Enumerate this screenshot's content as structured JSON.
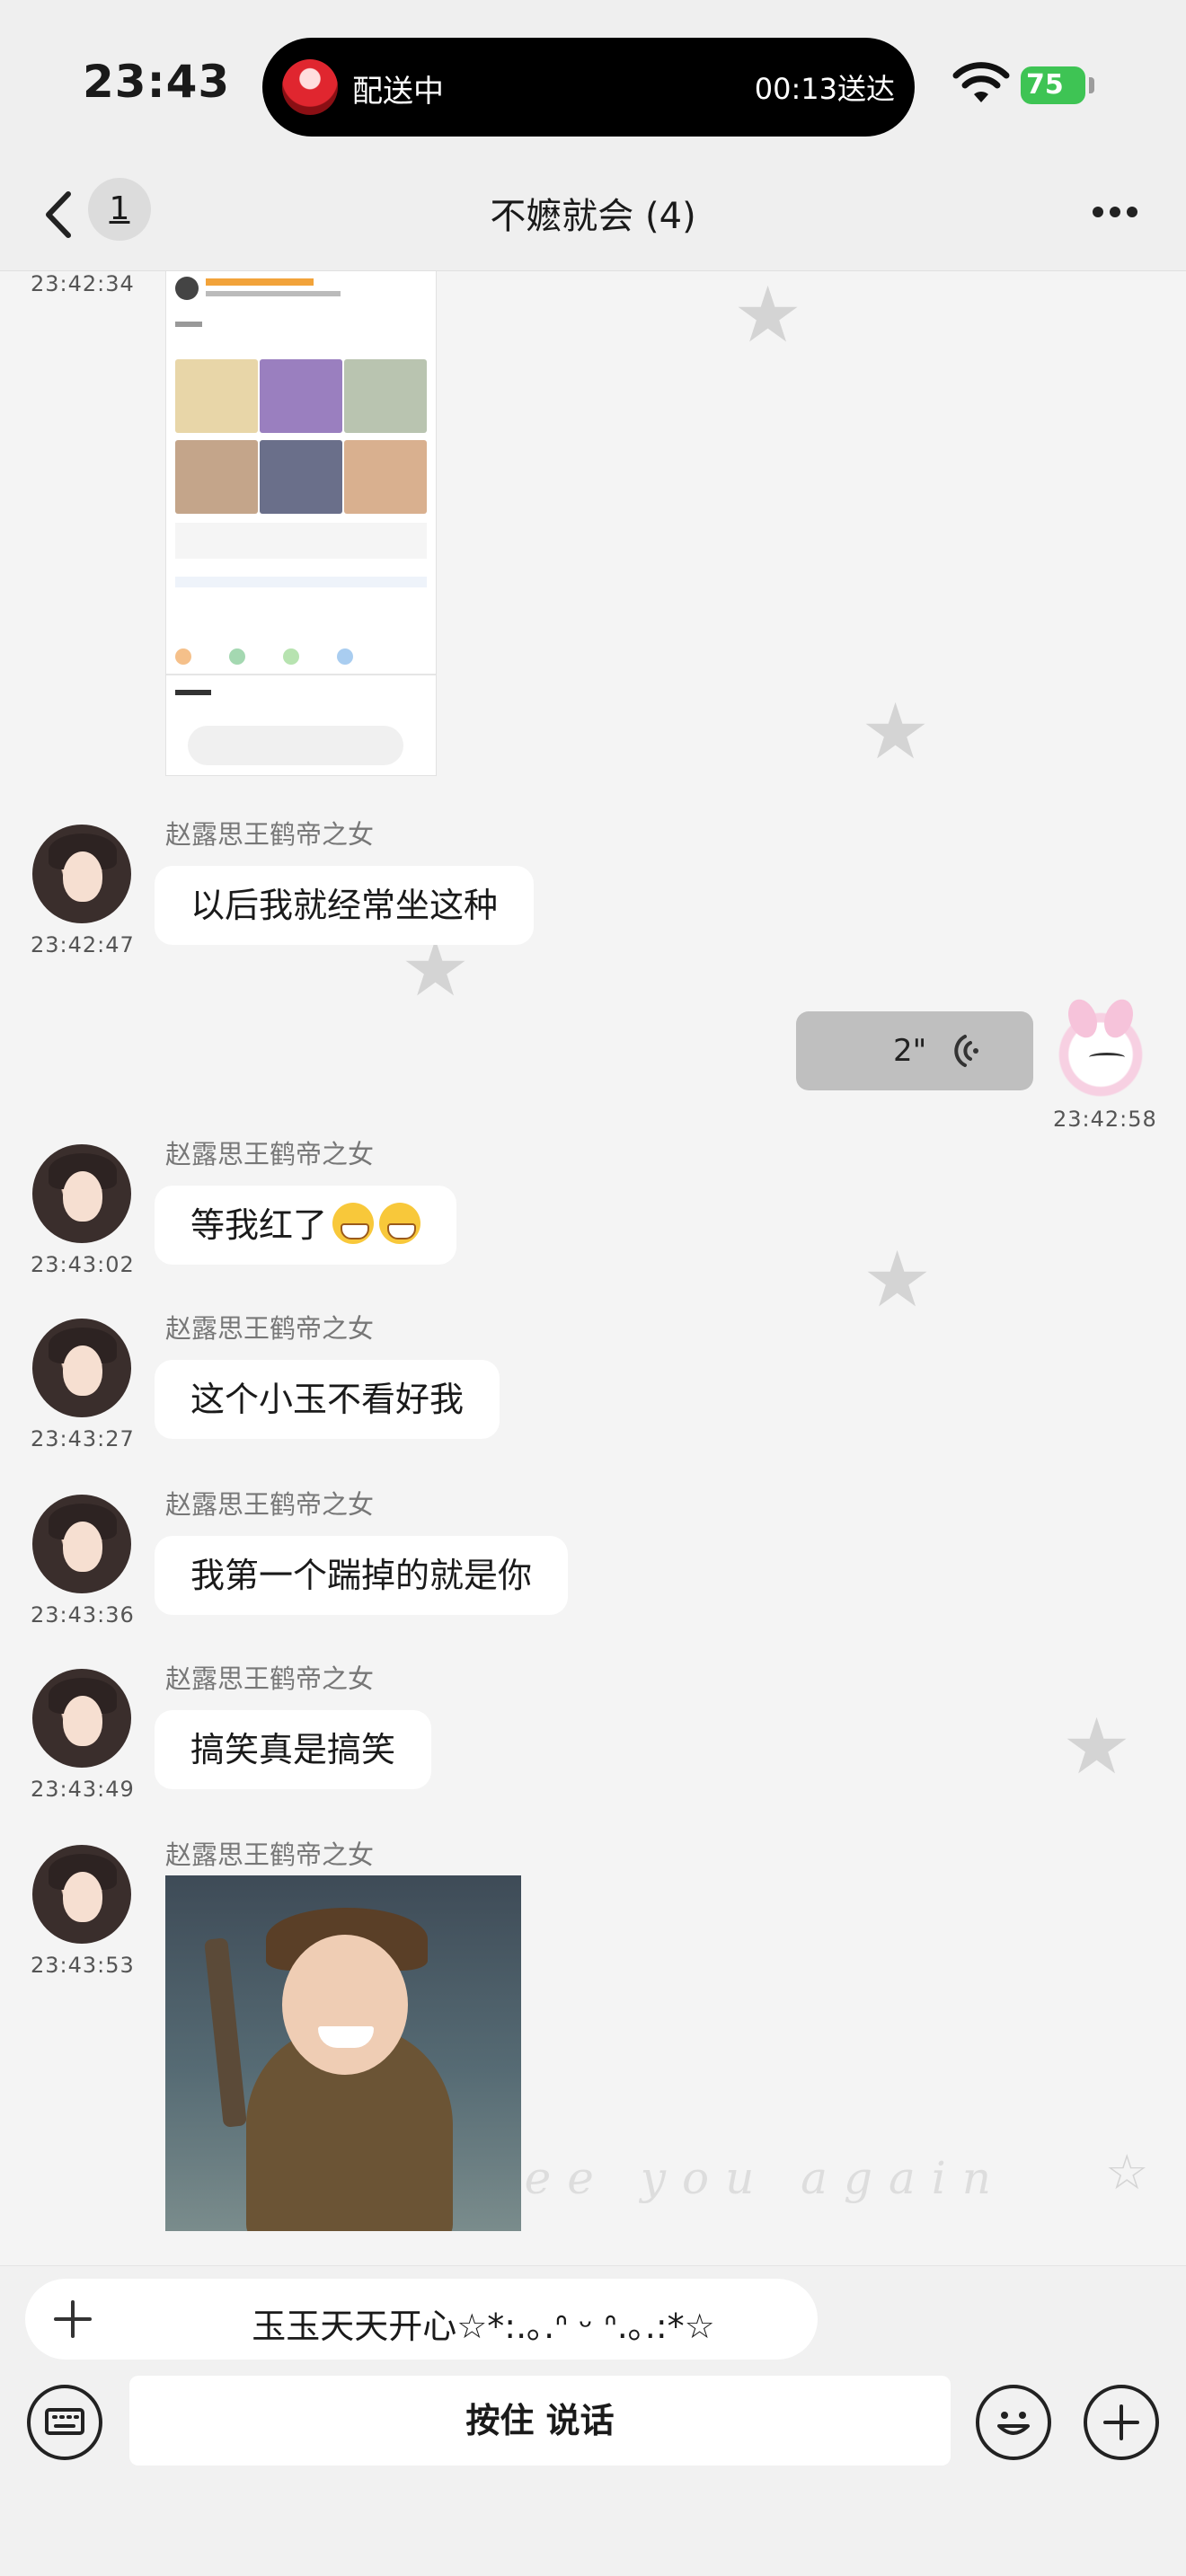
{
  "status_bar": {
    "time": "23:43",
    "island_label": "配送中",
    "island_eta": "00:13送达",
    "battery": "75"
  },
  "nav": {
    "unread_count": "1",
    "title": "不嬷就会 (4)"
  },
  "messages": [
    {
      "kind": "image",
      "from": "other",
      "time": "23:42:34",
      "content": "shared-screenshot"
    },
    {
      "kind": "text",
      "from": "other",
      "sender": "赵露思王鹤帝之女",
      "time": "23:42:47",
      "text": "以后我就经常坐这种"
    },
    {
      "kind": "voice",
      "from": "self",
      "time": "23:42:58",
      "duration": "2\""
    },
    {
      "kind": "text",
      "from": "other",
      "sender": "赵露思王鹤帝之女",
      "time": "23:43:02",
      "text": "等我红了",
      "emoji": [
        "grinning-emoji",
        "grinning-emoji"
      ]
    },
    {
      "kind": "text",
      "from": "other",
      "sender": "赵露思王鹤帝之女",
      "time": "23:43:27",
      "text": "这个小玉不看好我"
    },
    {
      "kind": "text",
      "from": "other",
      "sender": "赵露思王鹤帝之女",
      "time": "23:43:36",
      "text": "我第一个踹掉的就是你"
    },
    {
      "kind": "text",
      "from": "other",
      "sender": "赵露思王鹤帝之女",
      "time": "23:43:49",
      "text": "搞笑真是搞笑"
    },
    {
      "kind": "image",
      "from": "other",
      "sender": "赵露思王鹤帝之女",
      "time": "23:43:53",
      "content": "character-sticker"
    }
  ],
  "background_text": "see you again",
  "input": {
    "suggestion": "玉玉天天开心☆*:.｡.ᐢ ᵕ ᐢ.｡.:*☆",
    "hold_to_talk": "按住 说话"
  },
  "colors": {
    "page_bg": "#f4f4f4",
    "bubble_other": "#ffffff",
    "bubble_voice": "#bfbfbf",
    "battery": "#3ec454"
  }
}
